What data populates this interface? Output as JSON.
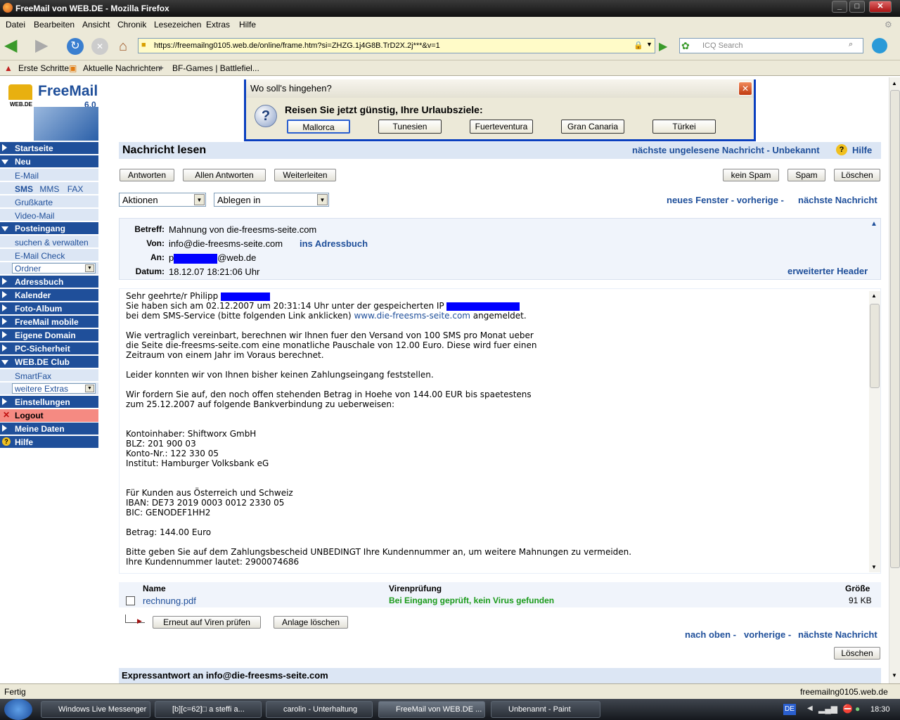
{
  "window": {
    "title": "FreeMail von WEB.DE - Mozilla Firefox"
  },
  "menu": [
    "Datei",
    "Bearbeiten",
    "Ansicht",
    "Chronik",
    "Lesezeichen",
    "Extras",
    "Hilfe"
  ],
  "url": "https://freemailng0105.web.de/online/frame.htm?si=ZHZG.1j4G8B.TrD2X.2j***&v=1",
  "search_placeholder": "ICQ Search",
  "bookmarks": [
    "Erste Schritte",
    "Aktuelle Nachrichten",
    "BF-Games | Battlefiel..."
  ],
  "logo": {
    "brand": "FreeMail",
    "version": "6.0",
    "sub": "WEB.DE"
  },
  "sidebar": {
    "startseite": "Startseite",
    "neu": "Neu",
    "email": "E-Mail",
    "sms": "SMS",
    "mms": "MMS",
    "fax": "FAX",
    "grusskarte": "Grußkarte",
    "videomail": "Video-Mail",
    "posteingang": "Posteingang",
    "suchen": "suchen & verwalten",
    "emailcheck": "E-Mail Check",
    "ordner": "Ordner",
    "adressbuch": "Adressbuch",
    "kalender": "Kalender",
    "fotoalbum": "Foto-Album",
    "mobile": "FreeMail mobile",
    "domain": "Eigene Domain",
    "pcsicher": "PC-Sicherheit",
    "club": "WEB.DE Club",
    "smartfax": "SmartFax",
    "extras": "weitere Extras",
    "einstellungen": "Einstellungen",
    "logout": "Logout",
    "meinedaten": "Meine Daten",
    "hilfe": "Hilfe"
  },
  "popup": {
    "title": "Wo soll's hingehen?",
    "question": "Reisen Sie jetzt günstig, Ihre Urlaubsziele:",
    "buttons": [
      "Mallorca",
      "Tunesien",
      "Fuerteventura",
      "Gran Canaria",
      "Türkei"
    ]
  },
  "main": {
    "title": "Nachricht lesen",
    "next_unread": "nächste ungelesene Nachricht - Unbekannt",
    "help": "Hilfe",
    "btn_reply": "Antworten",
    "btn_reply_all": "Allen Antworten",
    "btn_forward": "Weiterleiten",
    "btn_nospam": "kein Spam",
    "btn_spam": "Spam",
    "btn_delete": "Löschen",
    "actions": "Aktionen",
    "file_in": "Ablegen in",
    "nav_new_window": "neues Fenster - vorherige -",
    "nav_next": "nächste Nachricht"
  },
  "header": {
    "betreff_l": "Betreff:",
    "betreff": "Mahnung von die-freesms-seite.com",
    "von_l": "Von:",
    "von": "info@die-freesms-seite.com",
    "addr": "ins Adressbuch",
    "an_l": "An:",
    "an_a": "p",
    "an_b": "@web.de",
    "datum_l": "Datum:",
    "datum": "18.12.07 18:21:06 Uhr",
    "extended": "erweiterter Header"
  },
  "body": {
    "l1": "Sehr geehrte/r Philipp",
    "l2": "Sie haben sich am 02.12.2007 um 20:31:14 Uhr unter der gespeicherten IP",
    "l3a": "bei dem SMS-Service (bitte folgenden Link anklicken) ",
    "l3link": "www.die-freesms-seite.com",
    "l3b": " angemeldet.",
    "l4": "Wie vertraglich vereinbart, berechnen wir Ihnen fuer den Versand von 100 SMS pro Monat ueber",
    "l5": "die Seite die-freesms-seite.com eine monatliche Pauschale von 12.00 Euro. Diese wird fuer einen",
    "l6": "Zeitraum von einem Jahr im Voraus berechnet.",
    "l7": "Leider konnten wir von Ihnen bisher keinen Zahlungseingang feststellen.",
    "l8": "Wir fordern Sie auf, den noch offen stehenden Betrag in Hoehe von 144.00 EUR bis spaetestens",
    "l9": "zum 25.12.2007 auf folgende Bankverbindung zu ueberweisen:",
    "l10": "Kontoinhaber: Shiftworx GmbH",
    "l11": "BLZ: 201 900 03",
    "l12": "Konto-Nr.: 122 330 05",
    "l13": "Institut: Hamburger Volksbank eG",
    "l14": "Für Kunden aus Österreich und Schweiz",
    "l15": "IBAN: DE73 2019 0003 0012 2330 05",
    "l16": "BIC: GENODEF1HH2",
    "l17": "Betrag: 144.00 Euro",
    "l18": "Bitte geben Sie auf dem Zahlungsbescheid UNBEDINGT Ihre Kundennummer an, um weitere Mahnungen zu vermeiden.",
    "l19": "Ihre Kundennummer lautet: 2900074686"
  },
  "attach": {
    "col_name": "Name",
    "col_virus": "Virenprüfung",
    "col_size": "Größe",
    "file": "rechnung.pdf",
    "virus": "Bei Eingang geprüft, kein Virus gefunden",
    "size": "91 KB",
    "btn_rescan": "Erneut auf Viren prüfen",
    "btn_delete_att": "Anlage löschen"
  },
  "bottom": {
    "nav_top": "nach oben -",
    "nav_prev": "vorherige -",
    "nav_next": "nächste Nachricht",
    "btn_delete": "Löschen",
    "express": "Expressantwort an info@die-freesms-seite.com"
  },
  "status": {
    "left": "Fertig",
    "right": "freemailng0105.web.de"
  },
  "taskbar": {
    "items": [
      "Windows Live Messenger",
      "[b][c=62]□ a steffi  a...",
      "carolin - Unterhaltung",
      "FreeMail von WEB.DE ...",
      "Unbenannt - Paint"
    ],
    "lang": "DE",
    "time": "18:30"
  },
  "colors": {
    "accent": "#1f4f9a",
    "sidebar_sub": "#dce6f4",
    "logout": "#f58a82",
    "virus_ok": "#1a9a1a",
    "redaction": "#0000ff"
  }
}
